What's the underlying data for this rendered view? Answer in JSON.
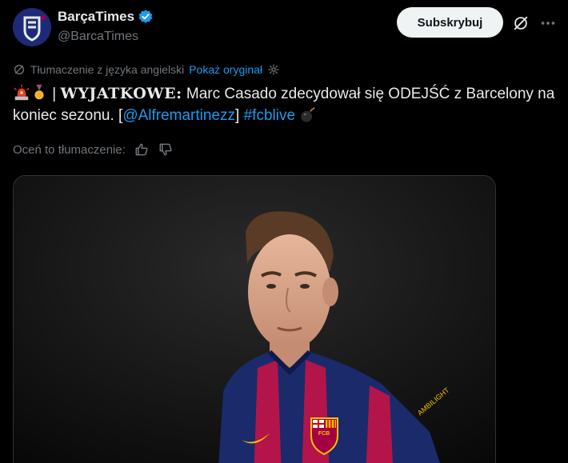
{
  "header": {
    "display_name": "BarçaTimes",
    "handle": "@BarcaTimes",
    "subscribe_label": "Subskrybuj",
    "verified_color": "#1d9bf0"
  },
  "translation": {
    "label": "Tłumaczenie z języka angielski",
    "show_original": "Pokaż oryginał"
  },
  "tweet": {
    "separator": " | ",
    "bold": "WYJATKOWE:",
    "text_part1": " Marc Casado zdecydował się ODEJŚĆ z Barcelony na koniec sezonu. [",
    "mention": "@Alfremartinezz",
    "text_part2": "] ",
    "hashtag": "#fcblive",
    "link_color": "#1d9bf0"
  },
  "rate": {
    "label": "Oceń to tłumaczenie:"
  },
  "media": {
    "jersey_text": "AMBILIGHT",
    "crest_text": "FCB"
  }
}
